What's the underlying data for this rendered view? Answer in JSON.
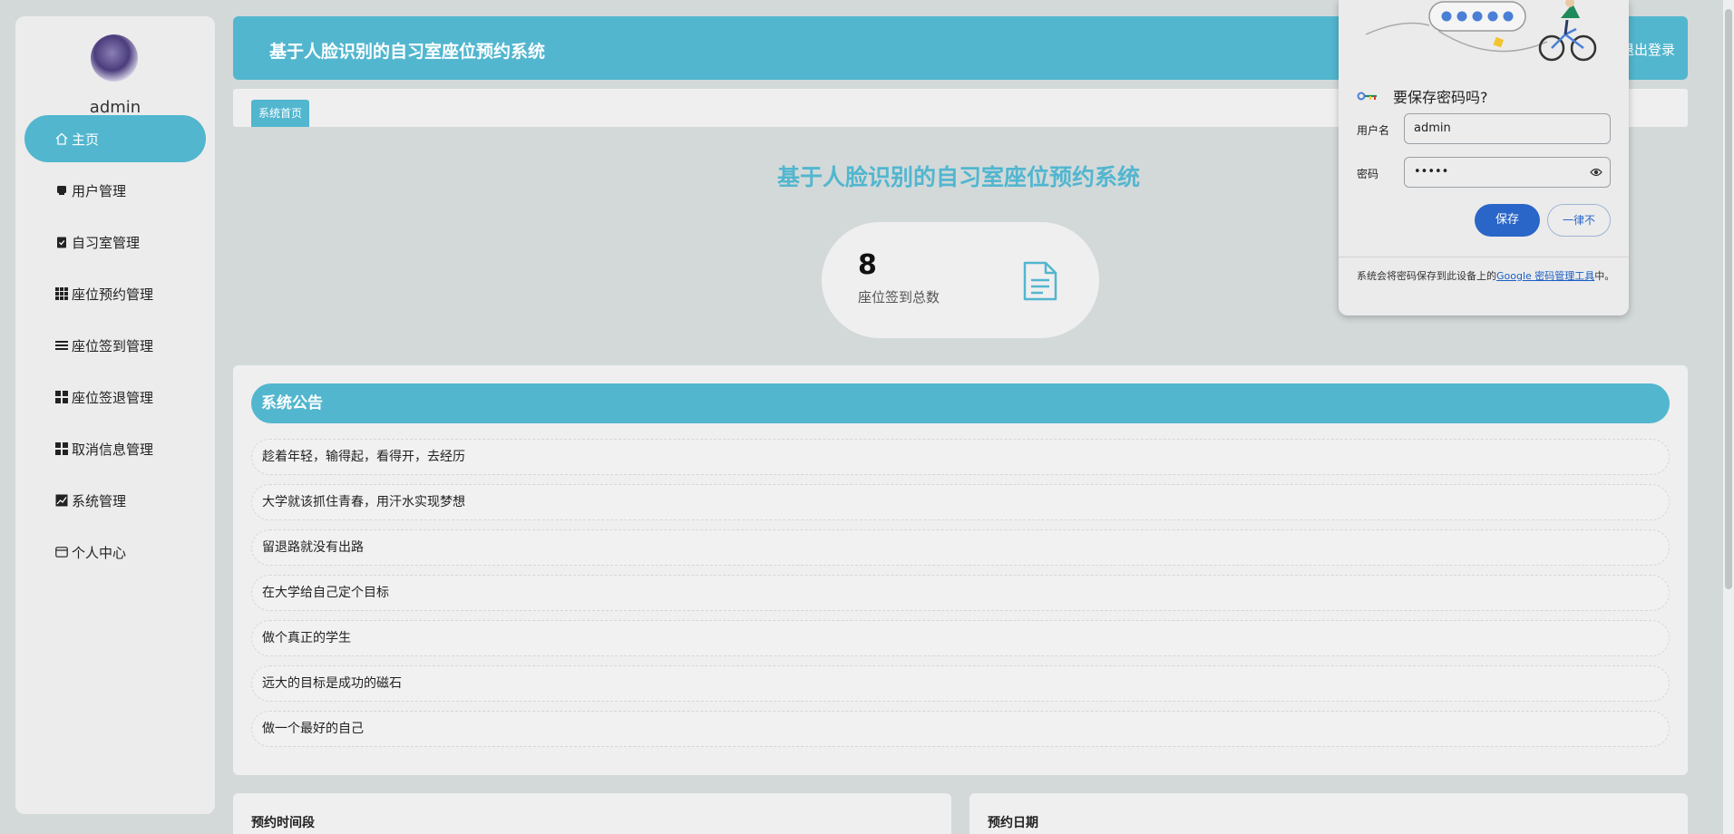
{
  "sidebar": {
    "username": "admin",
    "items": [
      {
        "label": "主页",
        "icon": "home-icon"
      },
      {
        "label": "用户管理",
        "icon": "user-card-icon"
      },
      {
        "label": "自习室管理",
        "icon": "clipboard-check-icon"
      },
      {
        "label": "座位预约管理",
        "icon": "grid-icon"
      },
      {
        "label": "座位签到管理",
        "icon": "list-icon"
      },
      {
        "label": "座位签退管理",
        "icon": "squares-icon"
      },
      {
        "label": "取消信息管理",
        "icon": "squares-icon"
      },
      {
        "label": "系统管理",
        "icon": "chart-icon"
      },
      {
        "label": "个人中心",
        "icon": "id-card-icon"
      }
    ]
  },
  "header": {
    "title": "基于人脸识别的自习室座位预约系统",
    "logout": "退出登录"
  },
  "breadcrumb": {
    "tab": "系统首页"
  },
  "main": {
    "title": "基于人脸识别的自习室座位预约系统",
    "stat": {
      "value": "8",
      "label": "座位签到总数"
    }
  },
  "notice": {
    "title": "系统公告",
    "items": [
      "趁着年轻，输得起，看得开，去经历",
      "大学就该抓住青春，用汗水实现梦想",
      "留退路就没有出路",
      "在大学给自己定个目标",
      "做个真正的学生",
      "远大的目标是成功的磁石",
      "做一个最好的自己"
    ]
  },
  "bottom_cards": {
    "left_title": "预约时间段",
    "right_title": "预约日期"
  },
  "password_popup": {
    "title": "要保存密码吗?",
    "username_label": "用户名",
    "username_value": "admin",
    "password_label": "密码",
    "password_value": "•••••",
    "save_label": "保存",
    "never_label": "一律不",
    "footer_prefix": "系统会将密码保存到此设备上的",
    "footer_link": "Google 密码管理工具",
    "footer_suffix": "中。"
  },
  "colors": {
    "accent": "#52b6cf",
    "background": "#d3d9d9",
    "button_blue": "#2a66c8"
  }
}
